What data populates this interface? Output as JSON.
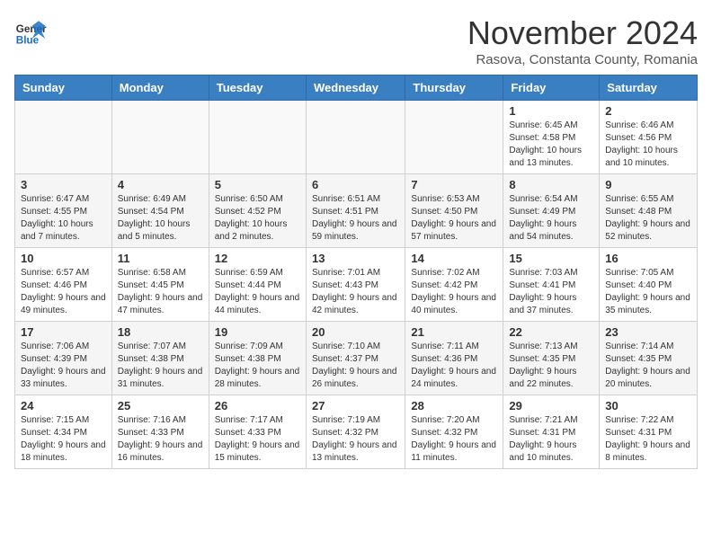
{
  "header": {
    "logo_general": "General",
    "logo_blue": "Blue",
    "month_title": "November 2024",
    "subtitle": "Rasova, Constanta County, Romania"
  },
  "weekdays": [
    "Sunday",
    "Monday",
    "Tuesday",
    "Wednesday",
    "Thursday",
    "Friday",
    "Saturday"
  ],
  "weeks": [
    [
      {
        "day": "",
        "info": ""
      },
      {
        "day": "",
        "info": ""
      },
      {
        "day": "",
        "info": ""
      },
      {
        "day": "",
        "info": ""
      },
      {
        "day": "",
        "info": ""
      },
      {
        "day": "1",
        "info": "Sunrise: 6:45 AM\nSunset: 4:58 PM\nDaylight: 10 hours and 13 minutes."
      },
      {
        "day": "2",
        "info": "Sunrise: 6:46 AM\nSunset: 4:56 PM\nDaylight: 10 hours and 10 minutes."
      }
    ],
    [
      {
        "day": "3",
        "info": "Sunrise: 6:47 AM\nSunset: 4:55 PM\nDaylight: 10 hours and 7 minutes."
      },
      {
        "day": "4",
        "info": "Sunrise: 6:49 AM\nSunset: 4:54 PM\nDaylight: 10 hours and 5 minutes."
      },
      {
        "day": "5",
        "info": "Sunrise: 6:50 AM\nSunset: 4:52 PM\nDaylight: 10 hours and 2 minutes."
      },
      {
        "day": "6",
        "info": "Sunrise: 6:51 AM\nSunset: 4:51 PM\nDaylight: 9 hours and 59 minutes."
      },
      {
        "day": "7",
        "info": "Sunrise: 6:53 AM\nSunset: 4:50 PM\nDaylight: 9 hours and 57 minutes."
      },
      {
        "day": "8",
        "info": "Sunrise: 6:54 AM\nSunset: 4:49 PM\nDaylight: 9 hours and 54 minutes."
      },
      {
        "day": "9",
        "info": "Sunrise: 6:55 AM\nSunset: 4:48 PM\nDaylight: 9 hours and 52 minutes."
      }
    ],
    [
      {
        "day": "10",
        "info": "Sunrise: 6:57 AM\nSunset: 4:46 PM\nDaylight: 9 hours and 49 minutes."
      },
      {
        "day": "11",
        "info": "Sunrise: 6:58 AM\nSunset: 4:45 PM\nDaylight: 9 hours and 47 minutes."
      },
      {
        "day": "12",
        "info": "Sunrise: 6:59 AM\nSunset: 4:44 PM\nDaylight: 9 hours and 44 minutes."
      },
      {
        "day": "13",
        "info": "Sunrise: 7:01 AM\nSunset: 4:43 PM\nDaylight: 9 hours and 42 minutes."
      },
      {
        "day": "14",
        "info": "Sunrise: 7:02 AM\nSunset: 4:42 PM\nDaylight: 9 hours and 40 minutes."
      },
      {
        "day": "15",
        "info": "Sunrise: 7:03 AM\nSunset: 4:41 PM\nDaylight: 9 hours and 37 minutes."
      },
      {
        "day": "16",
        "info": "Sunrise: 7:05 AM\nSunset: 4:40 PM\nDaylight: 9 hours and 35 minutes."
      }
    ],
    [
      {
        "day": "17",
        "info": "Sunrise: 7:06 AM\nSunset: 4:39 PM\nDaylight: 9 hours and 33 minutes."
      },
      {
        "day": "18",
        "info": "Sunrise: 7:07 AM\nSunset: 4:38 PM\nDaylight: 9 hours and 31 minutes."
      },
      {
        "day": "19",
        "info": "Sunrise: 7:09 AM\nSunset: 4:38 PM\nDaylight: 9 hours and 28 minutes."
      },
      {
        "day": "20",
        "info": "Sunrise: 7:10 AM\nSunset: 4:37 PM\nDaylight: 9 hours and 26 minutes."
      },
      {
        "day": "21",
        "info": "Sunrise: 7:11 AM\nSunset: 4:36 PM\nDaylight: 9 hours and 24 minutes."
      },
      {
        "day": "22",
        "info": "Sunrise: 7:13 AM\nSunset: 4:35 PM\nDaylight: 9 hours and 22 minutes."
      },
      {
        "day": "23",
        "info": "Sunrise: 7:14 AM\nSunset: 4:35 PM\nDaylight: 9 hours and 20 minutes."
      }
    ],
    [
      {
        "day": "24",
        "info": "Sunrise: 7:15 AM\nSunset: 4:34 PM\nDaylight: 9 hours and 18 minutes."
      },
      {
        "day": "25",
        "info": "Sunrise: 7:16 AM\nSunset: 4:33 PM\nDaylight: 9 hours and 16 minutes."
      },
      {
        "day": "26",
        "info": "Sunrise: 7:17 AM\nSunset: 4:33 PM\nDaylight: 9 hours and 15 minutes."
      },
      {
        "day": "27",
        "info": "Sunrise: 7:19 AM\nSunset: 4:32 PM\nDaylight: 9 hours and 13 minutes."
      },
      {
        "day": "28",
        "info": "Sunrise: 7:20 AM\nSunset: 4:32 PM\nDaylight: 9 hours and 11 minutes."
      },
      {
        "day": "29",
        "info": "Sunrise: 7:21 AM\nSunset: 4:31 PM\nDaylight: 9 hours and 10 minutes."
      },
      {
        "day": "30",
        "info": "Sunrise: 7:22 AM\nSunset: 4:31 PM\nDaylight: 9 hours and 8 minutes."
      }
    ]
  ]
}
